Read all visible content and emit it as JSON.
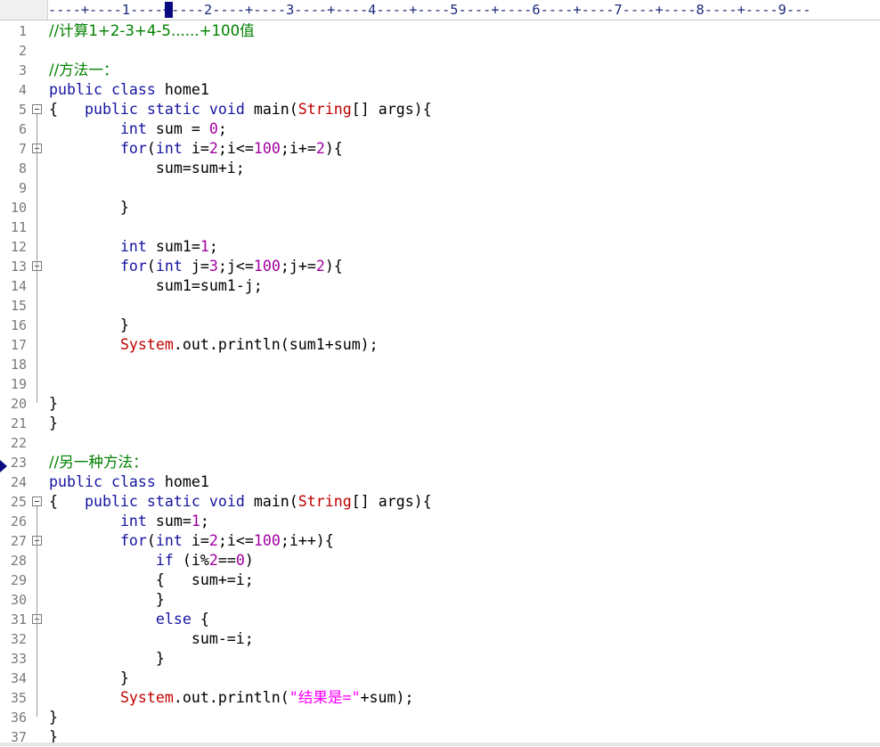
{
  "ruler": {
    "text": "----+----1----+----2----+----3----+----4----+----5----+----6----+----7----+----8----+----9---"
  },
  "colors": {
    "keyword": "#1515a0",
    "comment": "#008000",
    "number": "#a000a0",
    "class": "#c00000",
    "string": "#ff00ff",
    "line_number": "#7a7a7a"
  },
  "lines": [
    {
      "n": "1",
      "fold": false,
      "tokens": [
        {
          "t": "//计算1+2-3+4-5......+100值",
          "c": "cm"
        }
      ]
    },
    {
      "n": "2",
      "fold": false,
      "tokens": []
    },
    {
      "n": "3",
      "fold": false,
      "tokens": [
        {
          "t": "//方法一：",
          "c": "cm"
        }
      ]
    },
    {
      "n": "4",
      "fold": false,
      "tokens": [
        {
          "t": "public",
          "c": "kw"
        },
        {
          "t": " "
        },
        {
          "t": "class",
          "c": "kw"
        },
        {
          "t": " home1"
        }
      ]
    },
    {
      "n": "5",
      "fold": true,
      "tokens": [
        {
          "t": "{   "
        },
        {
          "t": "public",
          "c": "kw"
        },
        {
          "t": " "
        },
        {
          "t": "static",
          "c": "kw"
        },
        {
          "t": " "
        },
        {
          "t": "void",
          "c": "kw"
        },
        {
          "t": " main("
        },
        {
          "t": "String",
          "c": "cls"
        },
        {
          "t": "[] args){"
        }
      ]
    },
    {
      "n": "6",
      "fold": false,
      "tokens": [
        {
          "t": "        "
        },
        {
          "t": "int",
          "c": "kw"
        },
        {
          "t": " sum = "
        },
        {
          "t": "0",
          "c": "num"
        },
        {
          "t": ";"
        }
      ]
    },
    {
      "n": "7",
      "fold": true,
      "tokens": [
        {
          "t": "        "
        },
        {
          "t": "for",
          "c": "kw"
        },
        {
          "t": "("
        },
        {
          "t": "int",
          "c": "kw"
        },
        {
          "t": " i="
        },
        {
          "t": "2",
          "c": "num"
        },
        {
          "t": ";i<="
        },
        {
          "t": "100",
          "c": "num"
        },
        {
          "t": ";i+="
        },
        {
          "t": "2",
          "c": "num"
        },
        {
          "t": "){"
        }
      ]
    },
    {
      "n": "8",
      "fold": false,
      "tokens": [
        {
          "t": "            sum=sum+i;"
        }
      ]
    },
    {
      "n": "9",
      "fold": false,
      "tokens": []
    },
    {
      "n": "10",
      "fold": false,
      "tokens": [
        {
          "t": "        }"
        }
      ]
    },
    {
      "n": "11",
      "fold": false,
      "tokens": []
    },
    {
      "n": "12",
      "fold": false,
      "tokens": [
        {
          "t": "        "
        },
        {
          "t": "int",
          "c": "kw"
        },
        {
          "t": " sum1="
        },
        {
          "t": "1",
          "c": "num"
        },
        {
          "t": ";"
        }
      ]
    },
    {
      "n": "13",
      "fold": true,
      "tokens": [
        {
          "t": "        "
        },
        {
          "t": "for",
          "c": "kw"
        },
        {
          "t": "("
        },
        {
          "t": "int",
          "c": "kw"
        },
        {
          "t": " j="
        },
        {
          "t": "3",
          "c": "num"
        },
        {
          "t": ";j<="
        },
        {
          "t": "100",
          "c": "num"
        },
        {
          "t": ";j+="
        },
        {
          "t": "2",
          "c": "num"
        },
        {
          "t": "){"
        }
      ]
    },
    {
      "n": "14",
      "fold": false,
      "tokens": [
        {
          "t": "            sum1=sum1-j;"
        }
      ]
    },
    {
      "n": "15",
      "fold": false,
      "tokens": []
    },
    {
      "n": "16",
      "fold": false,
      "tokens": [
        {
          "t": "        }"
        }
      ]
    },
    {
      "n": "17",
      "fold": false,
      "tokens": [
        {
          "t": "        "
        },
        {
          "t": "System",
          "c": "cls"
        },
        {
          "t": ".out.println(sum1+sum);"
        }
      ]
    },
    {
      "n": "18",
      "fold": false,
      "tokens": []
    },
    {
      "n": "19",
      "fold": false,
      "tokens": []
    },
    {
      "n": "20",
      "fold": false,
      "tokens": [
        {
          "t": "}"
        }
      ]
    },
    {
      "n": "21",
      "fold": false,
      "tokens": [
        {
          "t": "}"
        }
      ]
    },
    {
      "n": "22",
      "fold": false,
      "tokens": []
    },
    {
      "n": "23",
      "fold": false,
      "tokens": [
        {
          "t": "//另一种方法：",
          "c": "cm"
        }
      ]
    },
    {
      "n": "24",
      "fold": false,
      "tokens": [
        {
          "t": "public",
          "c": "kw"
        },
        {
          "t": " "
        },
        {
          "t": "class",
          "c": "kw"
        },
        {
          "t": " home1"
        }
      ]
    },
    {
      "n": "25",
      "fold": true,
      "tokens": [
        {
          "t": "{   "
        },
        {
          "t": "public",
          "c": "kw"
        },
        {
          "t": " "
        },
        {
          "t": "static",
          "c": "kw"
        },
        {
          "t": " "
        },
        {
          "t": "void",
          "c": "kw"
        },
        {
          "t": " main("
        },
        {
          "t": "String",
          "c": "cls"
        },
        {
          "t": "[] args){"
        }
      ]
    },
    {
      "n": "26",
      "fold": false,
      "tokens": [
        {
          "t": "        "
        },
        {
          "t": "int",
          "c": "kw"
        },
        {
          "t": " sum="
        },
        {
          "t": "1",
          "c": "num"
        },
        {
          "t": ";"
        }
      ]
    },
    {
      "n": "27",
      "fold": true,
      "tokens": [
        {
          "t": "        "
        },
        {
          "t": "for",
          "c": "kw"
        },
        {
          "t": "("
        },
        {
          "t": "int",
          "c": "kw"
        },
        {
          "t": " i="
        },
        {
          "t": "2",
          "c": "num"
        },
        {
          "t": ";i<="
        },
        {
          "t": "100",
          "c": "num"
        },
        {
          "t": ";i++){"
        }
      ]
    },
    {
      "n": "28",
      "fold": false,
      "tokens": [
        {
          "t": "            "
        },
        {
          "t": "if",
          "c": "kw"
        },
        {
          "t": " (i%"
        },
        {
          "t": "2",
          "c": "num"
        },
        {
          "t": "=="
        },
        {
          "t": "0",
          "c": "num"
        },
        {
          "t": ")"
        }
      ]
    },
    {
      "n": "29",
      "fold": false,
      "tokens": [
        {
          "t": "            {   sum+=i;"
        }
      ]
    },
    {
      "n": "30",
      "fold": false,
      "tokens": [
        {
          "t": "            }"
        }
      ]
    },
    {
      "n": "31",
      "fold": true,
      "tokens": [
        {
          "t": "            "
        },
        {
          "t": "else",
          "c": "kw"
        },
        {
          "t": " {"
        }
      ]
    },
    {
      "n": "32",
      "fold": false,
      "tokens": [
        {
          "t": "                sum-=i;"
        }
      ]
    },
    {
      "n": "33",
      "fold": false,
      "tokens": [
        {
          "t": "            }"
        }
      ]
    },
    {
      "n": "34",
      "fold": false,
      "tokens": [
        {
          "t": "        }"
        }
      ]
    },
    {
      "n": "35",
      "fold": false,
      "tokens": [
        {
          "t": "        "
        },
        {
          "t": "System",
          "c": "cls"
        },
        {
          "t": ".out.println("
        },
        {
          "t": "\"结果是=\"",
          "c": "str"
        },
        {
          "t": "+sum);"
        }
      ]
    },
    {
      "n": "36",
      "fold": false,
      "tokens": [
        {
          "t": "}"
        }
      ]
    },
    {
      "n": "37",
      "fold": false,
      "tokens": [
        {
          "t": "}"
        }
      ]
    }
  ]
}
